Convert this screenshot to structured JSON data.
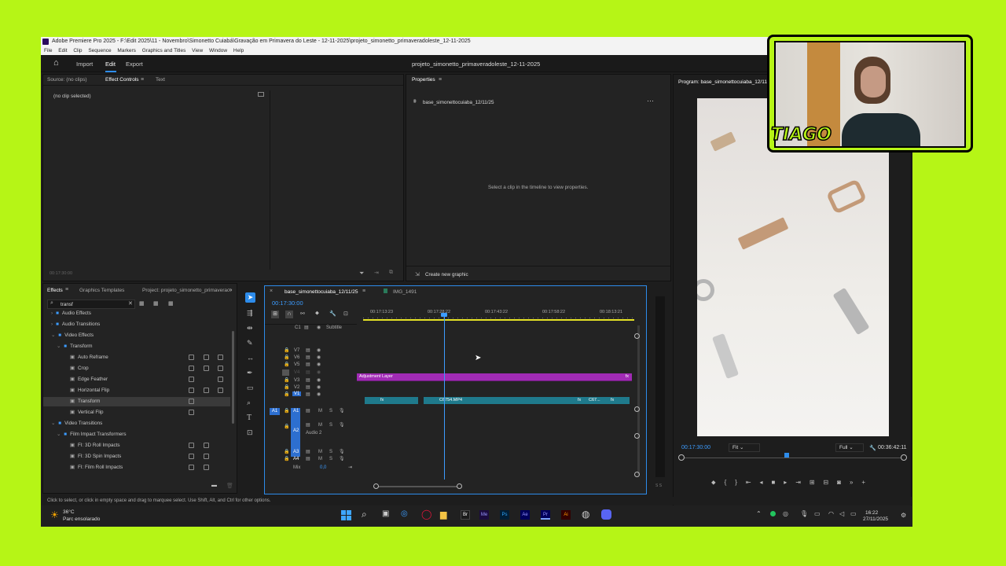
{
  "app": {
    "title_bar": "Adobe Premiere Pro 2025 - F:\\Edit 2025\\11 - Novembro\\Simonetto Cuiabá\\Gravação em Primavera do Leste - 12-11-2025\\projeto_simonetto_primaveradoleste_12-11-2025",
    "menu": [
      "File",
      "Edit",
      "Clip",
      "Sequence",
      "Markers",
      "Graphics and Titles",
      "View",
      "Window",
      "Help"
    ],
    "workspaces": [
      "Import",
      "Edit",
      "Export"
    ],
    "project_title": "projeto_simonetto_primaveradoleste_12-11-2025"
  },
  "effect_controls": {
    "tabs": [
      "Source: (no clips)",
      "Effect Controls",
      "Text"
    ],
    "no_clip": "(no clip selected)",
    "timecode": "00:17:30:00"
  },
  "properties": {
    "tab": "Properties",
    "sequence_name": "base_simonettocuiaba_12/11/25",
    "hint": "Select a clip in the timeline to view properties.",
    "create_graphic": "Create new graphic"
  },
  "program": {
    "tab": "Program: base_simonettocuiaba_12/11",
    "timecode": "00:17:30:00",
    "fit": "Fit",
    "quality": "Full",
    "duration": "00:36:42:11"
  },
  "effects": {
    "tabs": [
      "Effects",
      "Graphics Templates",
      "Project: projeto_simonetto_primaverac"
    ],
    "search_value": "transf",
    "tree": [
      {
        "label": "Audio Effects",
        "level": 1,
        "type": "folder",
        "expanded": false
      },
      {
        "label": "Audio Transitions",
        "level": 1,
        "type": "folder",
        "expanded": false
      },
      {
        "label": "Video Effects",
        "level": 1,
        "type": "folder",
        "expanded": true
      },
      {
        "label": "Transform",
        "level": 2,
        "type": "folder",
        "expanded": true
      },
      {
        "label": "Auto Reframe",
        "level": 3,
        "type": "effect"
      },
      {
        "label": "Crop",
        "level": 3,
        "type": "effect"
      },
      {
        "label": "Edge Feather",
        "level": 3,
        "type": "effect"
      },
      {
        "label": "Horizontal Flip",
        "level": 3,
        "type": "effect"
      },
      {
        "label": "Transform",
        "level": 3,
        "type": "effect",
        "selected": true
      },
      {
        "label": "Vertical Flip",
        "level": 3,
        "type": "effect"
      },
      {
        "label": "Video Transitions",
        "level": 1,
        "type": "folder",
        "expanded": true
      },
      {
        "label": "Film Impact Transformers",
        "level": 2,
        "type": "folder",
        "expanded": true
      },
      {
        "label": "FI: 3D Roll Impacts",
        "level": 3,
        "type": "effect"
      },
      {
        "label": "FI: 3D Spin Impacts",
        "level": 3,
        "type": "effect"
      },
      {
        "label": "FI: Film Roll Impacts",
        "level": 3,
        "type": "effect"
      }
    ]
  },
  "timeline": {
    "tabs": [
      "base_simonettocuiaba_12/11/25",
      "IMG_1491"
    ],
    "timecode": "00:17:30:00",
    "ruler": [
      "00:17:13:23",
      "00:17:28:22",
      "00:17:43:22",
      "00:17:58:22",
      "00:18:13:21"
    ],
    "subtitle_track": "Subtitle",
    "video_tracks": [
      "V7",
      "V6",
      "V5",
      "V4",
      "V3",
      "V2",
      "V1"
    ],
    "audio_tracks": [
      "A1",
      "A2",
      "A3",
      "A4"
    ],
    "audio2_name": "Audio 2",
    "mix_label": "Mix",
    "mix_value": "0,0",
    "adjustment_clip": "Adjustment Layer",
    "v1_clip": "C6754.MP4",
    "v1_clip2": "C67...",
    "fx": "fx",
    "c1": "C1",
    "m": "M",
    "s": "S"
  },
  "status_text": "Click to select, or click in empty space and drag to marquee select. Use Shift, Alt, and Ctrl for other options.",
  "taskbar": {
    "weather_temp": "36°C",
    "weather_desc": "Parc ensolarado",
    "time": "16:22",
    "date": "27/11/2025",
    "apps": [
      "Br",
      "Me",
      "Ps",
      "Ae",
      "Pr",
      "Ai"
    ]
  },
  "webcam_badge": "TIAGO",
  "colors": {
    "background": "#b6f516",
    "accent_blue": "#2d8ceb",
    "adjustment_clip": "#a12bb5",
    "video_clip": "#1f7a8c",
    "timecode_blue": "#3c9cff"
  }
}
